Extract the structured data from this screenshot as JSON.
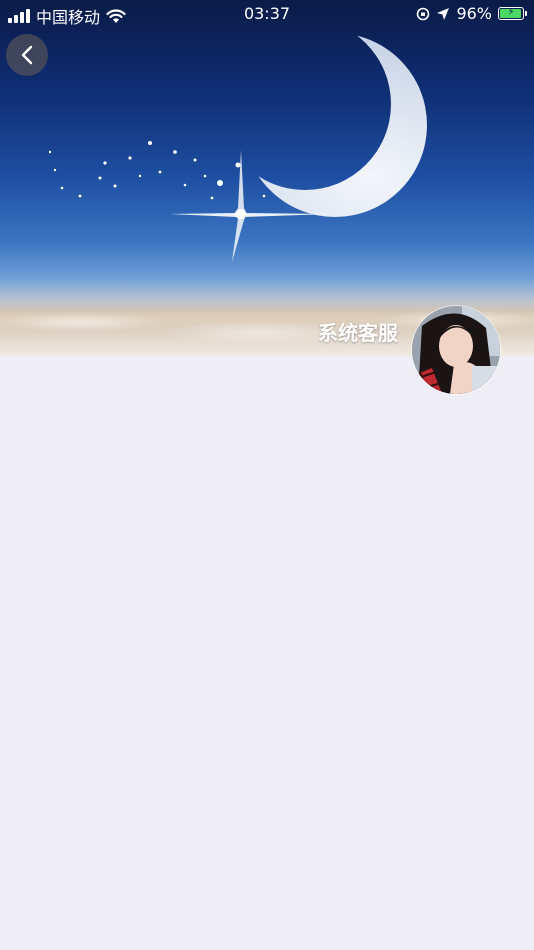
{
  "status_bar": {
    "carrier": "中国移动",
    "time": "03:37",
    "battery_percent": "96%",
    "battery_level": 0.96
  },
  "profile": {
    "name": "系统客服"
  },
  "icons": {
    "back": "chevron-left-icon",
    "wifi": "wifi-icon",
    "location": "location-arrow-icon",
    "orientation_lock": "orientation-lock-icon",
    "battery": "battery-charging-icon"
  },
  "colors": {
    "page_background": "#efeef4",
    "battery_green": "#4cd964",
    "text_white": "#ffffff"
  }
}
